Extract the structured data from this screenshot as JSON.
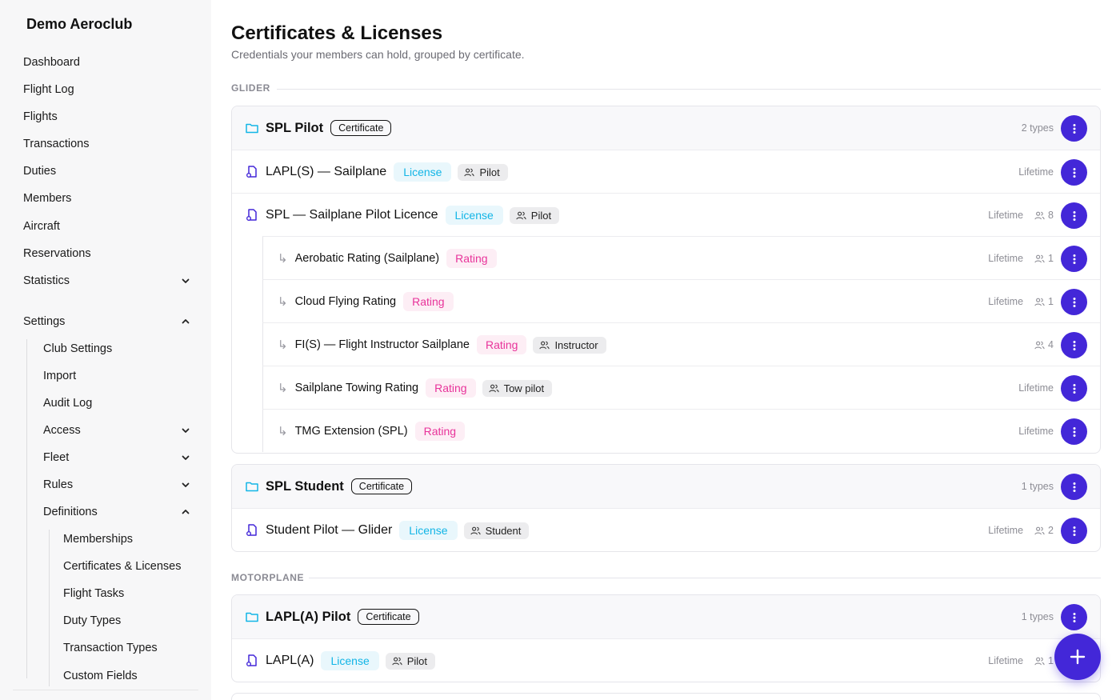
{
  "app": {
    "club_name": "Demo Aeroclub"
  },
  "nav": {
    "dashboard": "Dashboard",
    "flight_log": "Flight Log",
    "flights": "Flights",
    "transactions": "Transactions",
    "duties": "Duties",
    "members": "Members",
    "aircraft": "Aircraft",
    "reservations": "Reservations",
    "statistics": "Statistics",
    "settings": "Settings",
    "club_settings": "Club Settings",
    "import": "Import",
    "audit_log": "Audit Log",
    "access": "Access",
    "fleet": "Fleet",
    "rules": "Rules",
    "definitions": "Definitions",
    "memberships": "Memberships",
    "certificates_licenses": "Certificates & Licenses",
    "flight_tasks": "Flight Tasks",
    "duty_types": "Duty Types",
    "transaction_types": "Transaction Types",
    "custom_fields": "Custom Fields"
  },
  "page": {
    "title": "Certificates & Licenses",
    "subtitle": "Credentials your members can hold, grouped by certificate."
  },
  "tags": {
    "certificate": "Certificate",
    "license": "License",
    "rating": "Rating"
  },
  "groups": {
    "glider": {
      "label": "GLIDER",
      "spl_pilot": {
        "name": "SPL Pilot",
        "types": "2 types",
        "lapl_s": {
          "name": "LAPL(S) — Sailplane",
          "role": "Pilot",
          "validity": "Lifetime"
        },
        "spl": {
          "name": "SPL — Sailplane Pilot Licence",
          "role": "Pilot",
          "validity": "Lifetime",
          "count": "8",
          "aerobatic": {
            "name": "Aerobatic Rating (Sailplane)",
            "validity": "Lifetime",
            "count": "1"
          },
          "cloud": {
            "name": "Cloud Flying Rating",
            "validity": "Lifetime",
            "count": "1"
          },
          "fi": {
            "name": "FI(S) — Flight Instructor Sailplane",
            "role": "Instructor",
            "count": "4"
          },
          "towing": {
            "name": "Sailplane Towing Rating",
            "role": "Tow pilot",
            "validity": "Lifetime"
          },
          "tmg": {
            "name": "TMG Extension (SPL)",
            "validity": "Lifetime"
          }
        }
      },
      "spl_student": {
        "name": "SPL Student",
        "types": "1 types",
        "student": {
          "name": "Student Pilot — Glider",
          "role": "Student",
          "validity": "Lifetime",
          "count": "2"
        }
      }
    },
    "motorplane": {
      "label": "MOTORPLANE",
      "lapl_a_pilot": {
        "name": "LAPL(A) Pilot",
        "types": "1 types",
        "lapl_a": {
          "name": "LAPL(A)",
          "role": "Pilot",
          "validity": "Lifetime",
          "count": "1"
        }
      }
    }
  },
  "colors": {
    "accent": "#4327d8",
    "license": "#12b5e6",
    "rating": "#e8339a"
  }
}
